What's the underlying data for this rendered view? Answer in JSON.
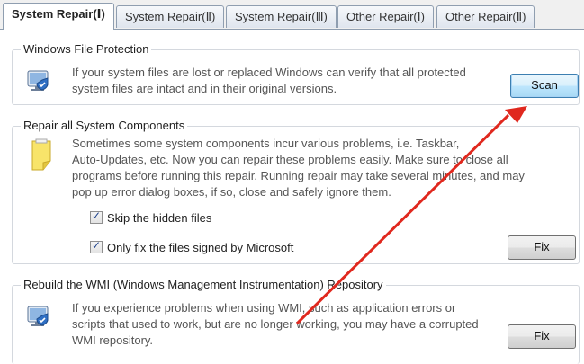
{
  "tabs": [
    {
      "label": "System Repair(Ⅰ)",
      "active": true
    },
    {
      "label": "System Repair(Ⅱ)",
      "active": false
    },
    {
      "label": "System Repair(Ⅲ)",
      "active": false
    },
    {
      "label": "Other Repair(Ⅰ)",
      "active": false
    },
    {
      "label": "Other Repair(Ⅱ)",
      "active": false
    }
  ],
  "wfp": {
    "title": "Windows File Protection",
    "line1": "If your system files are lost or replaced Windows can verify that all protected",
    "line2": "system files are intact and in their original versions.",
    "button": "Scan",
    "icon": "monitor-shield-icon"
  },
  "components": {
    "title": "Repair all System Components",
    "line1": "Sometimes some system components incur various problems, i.e. Taskbar,",
    "line2": "Auto-Updates, etc.  Now you can repair these problems easily. Make sure to close all",
    "line3": "programs before running this repair. Running repair may take several minutes, and may",
    "line4": "pop up error dialog boxes, if so, close and safely ignore them.",
    "check1": "Skip the hidden files",
    "check1_checked": true,
    "check2": "Only fix the files signed by Microsoft",
    "check2_checked": true,
    "button": "Fix",
    "icon": "sticky-note-icon"
  },
  "wmi": {
    "title": "Rebuild the WMI (Windows Management Instrumentation) Repository",
    "line1": "If you experience problems when using WMI, such as application errors or",
    "line2": "scripts that used to work, but are no longer working, you may have a corrupted",
    "line3": "WMI repository.",
    "button": "Fix",
    "icon": "monitor-shield-icon"
  },
  "annotation": {
    "color": "#e0281e"
  }
}
